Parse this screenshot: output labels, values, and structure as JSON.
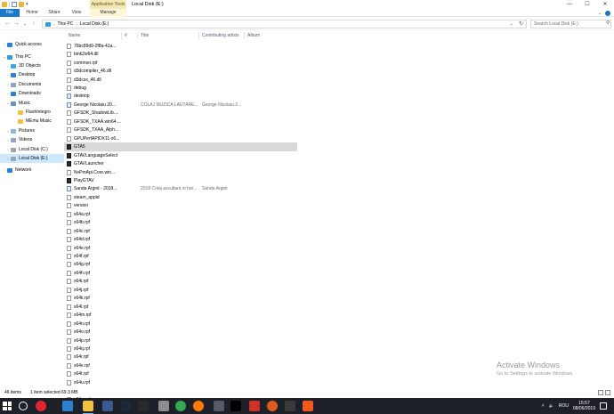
{
  "window": {
    "title": "Local Disk (E:)",
    "app_tools_label": "Application Tools",
    "controls": [
      "—",
      "☐",
      "✕"
    ]
  },
  "ribbon": {
    "tabs": [
      "File",
      "Home",
      "Share",
      "View",
      "Manage"
    ],
    "help": "?"
  },
  "address": {
    "crumbs": [
      "This PC",
      "Local Disk (E:)"
    ],
    "search_placeholder": "Search Local Disk (E:)"
  },
  "nav": {
    "items": [
      {
        "label": "Quick access",
        "icon": "star-icon",
        "color": "#2c7fd6"
      },
      {
        "label": "This PC",
        "icon": "computer-icon",
        "color": "#2c9be0"
      },
      {
        "label": "3D Objects",
        "icon": "cube-icon",
        "color": "#3aa7e6"
      },
      {
        "label": "Desktop",
        "icon": "desktop-icon",
        "color": "#2c7fd6"
      },
      {
        "label": "Documents",
        "icon": "documents-icon",
        "color": "#8da3bf"
      },
      {
        "label": "Downloads",
        "icon": "download-icon",
        "color": "#2c7fd6"
      },
      {
        "label": "Music",
        "icon": "music-icon",
        "color": "#6b8fc4"
      },
      {
        "label": "FlashIntegro",
        "icon": "folder-icon",
        "color": "#f0c240"
      },
      {
        "label": "MEmu Music",
        "icon": "folder-icon",
        "color": "#f0c240"
      },
      {
        "label": "Pictures",
        "icon": "pictures-icon",
        "color": "#8db6df"
      },
      {
        "label": "Videos",
        "icon": "videos-icon",
        "color": "#8da3bf"
      },
      {
        "label": "Local Disk (C:)",
        "icon": "drive-icon",
        "color": "#9aa6b3"
      },
      {
        "label": "Local Disk (E:)",
        "icon": "drive-icon",
        "color": "#9aa6b3"
      },
      {
        "label": "Network",
        "icon": "network-icon",
        "color": "#2c7fd6"
      }
    ]
  },
  "columns": {
    "name": "Name",
    "number": "#",
    "title": "Title",
    "artists": "Contributing artists",
    "album": "Album"
  },
  "files": [
    {
      "name": "76bc89d9-2f8a-41a...",
      "kind": "file",
      "title": "",
      "artist": ""
    },
    {
      "name": "bink2w64.dll",
      "kind": "file",
      "title": "",
      "artist": ""
    },
    {
      "name": "common.rpf",
      "kind": "file",
      "title": "",
      "artist": ""
    },
    {
      "name": "d3dcompiler_46.dll",
      "kind": "file",
      "title": "",
      "artist": ""
    },
    {
      "name": "d3dcsx_46.dll",
      "kind": "file",
      "title": "",
      "artist": ""
    },
    {
      "name": "debug",
      "kind": "file",
      "title": "",
      "artist": ""
    },
    {
      "name": "desktop",
      "kind": "gear",
      "title": "",
      "artist": ""
    },
    {
      "name": "George Nicolaiu 20...",
      "kind": "music",
      "title": "COLAJ MUZICA LAUTARE...",
      "artist": "George Nicolaiu 2..."
    },
    {
      "name": "GFSDK_ShadowLib....",
      "kind": "file",
      "title": "",
      "artist": ""
    },
    {
      "name": "GFSDK_TXAA.win64....",
      "kind": "file",
      "title": "",
      "artist": ""
    },
    {
      "name": "GFSDK_TXAA_Alph...",
      "kind": "file",
      "title": "",
      "artist": ""
    },
    {
      "name": "GPUPerfAPIDX11-x6...",
      "kind": "file",
      "title": "",
      "artist": ""
    },
    {
      "name": "GTA5",
      "kind": "gta",
      "title": "",
      "artist": ""
    },
    {
      "name": "GTAVLanguageSelect",
      "kind": "gta",
      "title": "",
      "artist": ""
    },
    {
      "name": "GTAVLauncher",
      "kind": "gta",
      "title": "",
      "artist": ""
    },
    {
      "name": "NvPmApi.Core.win...",
      "kind": "file",
      "title": "",
      "artist": ""
    },
    {
      "name": "PlayGTAV",
      "kind": "gta",
      "title": "",
      "artist": ""
    },
    {
      "name": "Sanda Argint - 2018...",
      "kind": "music",
      "title": "2018 Colaj ascultare si hor...",
      "artist": "Sanda Argint"
    },
    {
      "name": "steam_appid",
      "kind": "file",
      "title": "",
      "artist": ""
    },
    {
      "name": "version",
      "kind": "file",
      "title": "",
      "artist": ""
    },
    {
      "name": "x64a.rpf",
      "kind": "file",
      "title": "",
      "artist": ""
    },
    {
      "name": "x64b.rpf",
      "kind": "file",
      "title": "",
      "artist": ""
    },
    {
      "name": "x64c.rpf",
      "kind": "file",
      "title": "",
      "artist": ""
    },
    {
      "name": "x64d.rpf",
      "kind": "file",
      "title": "",
      "artist": ""
    },
    {
      "name": "x64e.rpf",
      "kind": "file",
      "title": "",
      "artist": ""
    },
    {
      "name": "x64f.rpf",
      "kind": "file",
      "title": "",
      "artist": ""
    },
    {
      "name": "x64g.rpf",
      "kind": "file",
      "title": "",
      "artist": ""
    },
    {
      "name": "x64h.rpf",
      "kind": "file",
      "title": "",
      "artist": ""
    },
    {
      "name": "x64i.rpf",
      "kind": "file",
      "title": "",
      "artist": ""
    },
    {
      "name": "x64j.rpf",
      "kind": "file",
      "title": "",
      "artist": ""
    },
    {
      "name": "x64k.rpf",
      "kind": "file",
      "title": "",
      "artist": ""
    },
    {
      "name": "x64l.rpf",
      "kind": "file",
      "title": "",
      "artist": ""
    },
    {
      "name": "x64m.rpf",
      "kind": "file",
      "title": "",
      "artist": ""
    },
    {
      "name": "x64n.rpf",
      "kind": "file",
      "title": "",
      "artist": ""
    },
    {
      "name": "x64o.rpf",
      "kind": "file",
      "title": "",
      "artist": ""
    },
    {
      "name": "x64p.rpf",
      "kind": "file",
      "title": "",
      "artist": ""
    },
    {
      "name": "x64q.rpf",
      "kind": "file",
      "title": "",
      "artist": ""
    },
    {
      "name": "x64r.rpf",
      "kind": "file",
      "title": "",
      "artist": ""
    },
    {
      "name": "x64s.rpf",
      "kind": "file",
      "title": "",
      "artist": ""
    },
    {
      "name": "x64t.rpf",
      "kind": "file",
      "title": "",
      "artist": ""
    },
    {
      "name": "x64u.rpf",
      "kind": "file",
      "title": "",
      "artist": ""
    },
    {
      "name": "x64v.rpf",
      "kind": "file",
      "title": "",
      "artist": ""
    },
    {
      "name": "x64w.rpf",
      "kind": "file",
      "title": "",
      "artist": ""
    }
  ],
  "selected_file": "GTA5",
  "status": {
    "items": "46 items",
    "selected": "1 item selected  69.3 MB"
  },
  "watermark": {
    "title": "Activate Windows",
    "subtitle": "Go to Settings to activate Windows."
  },
  "taskbar": {
    "apps": [
      {
        "name": "opera-icon",
        "color": "#e0262f"
      },
      {
        "name": "edge-icon",
        "color": "#2f7fd0"
      },
      {
        "name": "file-explorer-icon",
        "color": "#f0c240"
      },
      {
        "name": "media-icon",
        "color": "#3b5b8f"
      },
      {
        "name": "steam-icon",
        "color": "#1b2838"
      },
      {
        "name": "epic-games-icon",
        "color": "#2a2a2a"
      },
      {
        "name": "flag-icon",
        "color": "#8c8c8c"
      },
      {
        "name": "chrome-icon",
        "color": "#34a853"
      },
      {
        "name": "firefox-icon",
        "color": "#ff7a00"
      },
      {
        "name": "gamepad-icon",
        "color": "#555a66"
      },
      {
        "name": "rockstar-icon",
        "color": "#000000"
      },
      {
        "name": "arrow-icon",
        "color": "#d0302a"
      },
      {
        "name": "circle-app-icon",
        "color": "#e05a1e"
      },
      {
        "name": "sword-icon",
        "color": "#3a3a3a"
      },
      {
        "name": "origin-icon",
        "color": "#f25a1d"
      }
    ],
    "lang": "ROU",
    "time": "15:57",
    "date": "08/06/2019"
  },
  "colors": {
    "accent": "#1979ca",
    "selection": "#cce8ff",
    "row_selected": "#d9d9d9",
    "taskbar": "#1e2029"
  }
}
